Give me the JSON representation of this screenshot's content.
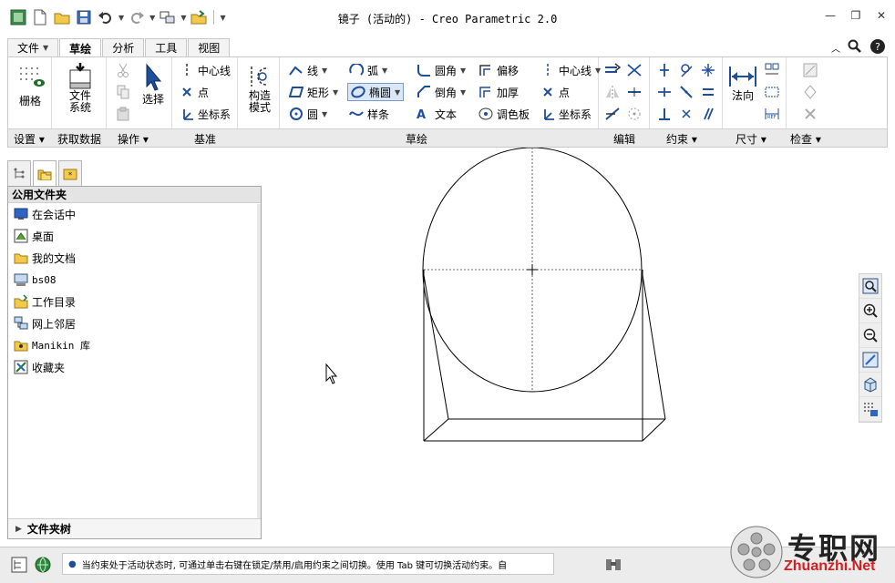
{
  "window": {
    "title": "镜子 (活动的) - Creo Parametric 2.0",
    "controls": [
      "—",
      "❐",
      "✕"
    ]
  },
  "menu_tabs": [
    {
      "label": "文件",
      "dropdown": true
    },
    {
      "label": "草绘",
      "active": true
    },
    {
      "label": "分析"
    },
    {
      "label": "工具"
    },
    {
      "label": "视图"
    }
  ],
  "ribbon": {
    "grid_btn": "栅格",
    "file_system_btn": "文件\n系统",
    "select_btn": "选择",
    "datum": {
      "centerline": "中心线",
      "point": "点",
      "csys": "坐标系"
    },
    "construction_mode_btn": "构造\n模式",
    "sketch": {
      "line": "线",
      "rectangle": "矩形",
      "circle": "圆",
      "arc": "弧",
      "ellipse": "椭圆",
      "spline": "样条",
      "fillet": "圆角",
      "chamfer": "倒角",
      "text": "文本",
      "offset": "偏移",
      "thicken": "加厚",
      "palette": "调色板",
      "centerline": "中心线",
      "point": "点",
      "csys": "坐标系"
    },
    "normal_btn": "法向",
    "group_labels": {
      "setup": "设置",
      "get_data": "获取数据",
      "operations": "操作",
      "datum": "基准",
      "sketching": "草绘",
      "editing": "编辑",
      "constrain": "约束",
      "dimension": "尺寸",
      "inspect": "检查"
    }
  },
  "folder_browser": {
    "header": "公用文件夹",
    "items": [
      "在会话中",
      "桌面",
      "我的文档",
      "bs08",
      "工作目录",
      "网上邻居",
      "Manikin 库",
      "收藏夹"
    ],
    "footer": "文件夹树"
  },
  "status": {
    "message": "当约束处于活动状态时, 可通过单击右键在锁定/禁用/启用约束之间切换。使用 Tab 键可切换活动约束。自"
  },
  "watermark": {
    "cn": "专职网",
    "en": "Zhuanzhi.Net"
  },
  "colors": {
    "accent": "#1f4e9a",
    "ribbon_bg": "#ffffff",
    "group_label_bg": "#eaeaea"
  }
}
